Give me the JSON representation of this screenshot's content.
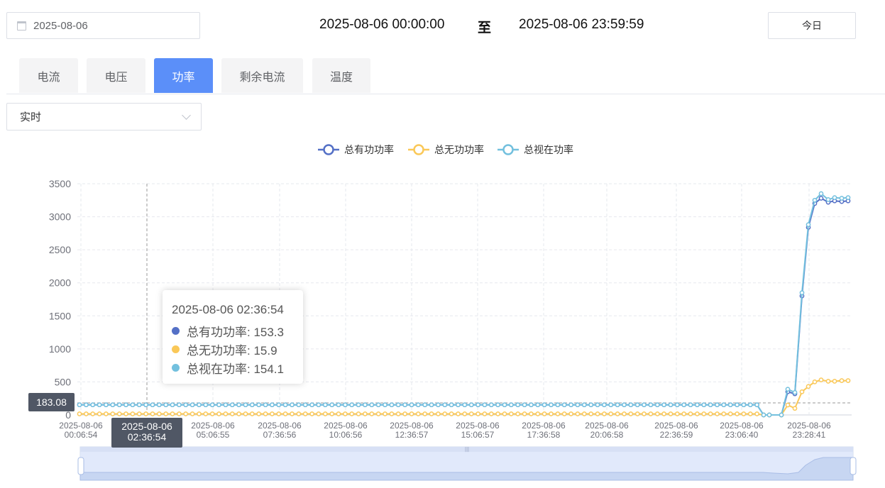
{
  "toolbar": {
    "date_value": "2025-08-06",
    "range_start": "2025-08-06 00:00:00",
    "range_sep": "至",
    "range_end": "2025-08-06 23:59:59",
    "today_label": "今日"
  },
  "tabs": [
    {
      "label": "电流",
      "active": false
    },
    {
      "label": "电压",
      "active": false
    },
    {
      "label": "功率",
      "active": true
    },
    {
      "label": "剩余电流",
      "active": false
    },
    {
      "label": "温度",
      "active": false
    }
  ],
  "mode_select": {
    "value": "实时",
    "icon": "chevron-down-icon"
  },
  "chart_data": {
    "type": "line",
    "title": "",
    "ylim": [
      0,
      3500
    ],
    "yticks": [
      0,
      500,
      1000,
      1500,
      2000,
      2500,
      3000,
      3500
    ],
    "xtick_labels": [
      [
        "2025-08-06",
        "00:06:54"
      ],
      [
        "2025-08-06",
        "02:36:54"
      ],
      [
        "2025-08-06",
        "05:06:55"
      ],
      [
        "2025-08-06",
        "07:36:56"
      ],
      [
        "2025-08-06",
        "10:06:56"
      ],
      [
        "2025-08-06",
        "12:36:57"
      ],
      [
        "2025-08-06",
        "15:06:57"
      ],
      [
        "2025-08-06",
        "17:36:58"
      ],
      [
        "2025-08-06",
        "20:06:58"
      ],
      [
        "2025-08-06",
        "22:36:59"
      ],
      [
        "2025-08-06",
        "23:06:40"
      ],
      [
        "2025-08-06",
        "23:28:41"
      ]
    ],
    "grid": true,
    "legend_position": "top-center",
    "colors": {
      "active": "#5470c6",
      "reactive": "#fac858",
      "apparent": "#73c0de"
    },
    "series": [
      {
        "name": "总有功功率",
        "color": "#5470c6",
        "baseline": {
          "count": 104,
          "value": 153
        },
        "tail": [
          0,
          0,
          0,
          350,
          320,
          1800,
          2840,
          3200,
          3280,
          3220,
          3240,
          3230,
          3240
        ]
      },
      {
        "name": "总无功功率",
        "color": "#fac858",
        "baseline": {
          "count": 104,
          "value": 16
        },
        "tail": [
          0,
          0,
          0,
          150,
          100,
          350,
          430,
          500,
          530,
          510,
          510,
          520,
          520
        ]
      },
      {
        "name": "总视在功率",
        "color": "#73c0de",
        "baseline": {
          "count": 104,
          "value": 154
        },
        "tail": [
          0,
          0,
          0,
          390,
          340,
          1850,
          2880,
          3250,
          3350,
          3260,
          3290,
          3280,
          3290
        ]
      }
    ],
    "crosshair": {
      "y_label": "183.08",
      "x_label": [
        "2025-08-06",
        "02:36:54"
      ],
      "y_value": 183.08
    },
    "tooltip": {
      "title": "2025-08-06 02:36:54",
      "rows": [
        {
          "label": "总有功功率: 153.3",
          "color": "#5470c6"
        },
        {
          "label": "总无功功率: 15.9",
          "color": "#fac858"
        },
        {
          "label": "总视在功率: 154.1",
          "color": "#73c0de"
        }
      ]
    }
  },
  "zoom_handle_icon": "drag-grip-icon"
}
